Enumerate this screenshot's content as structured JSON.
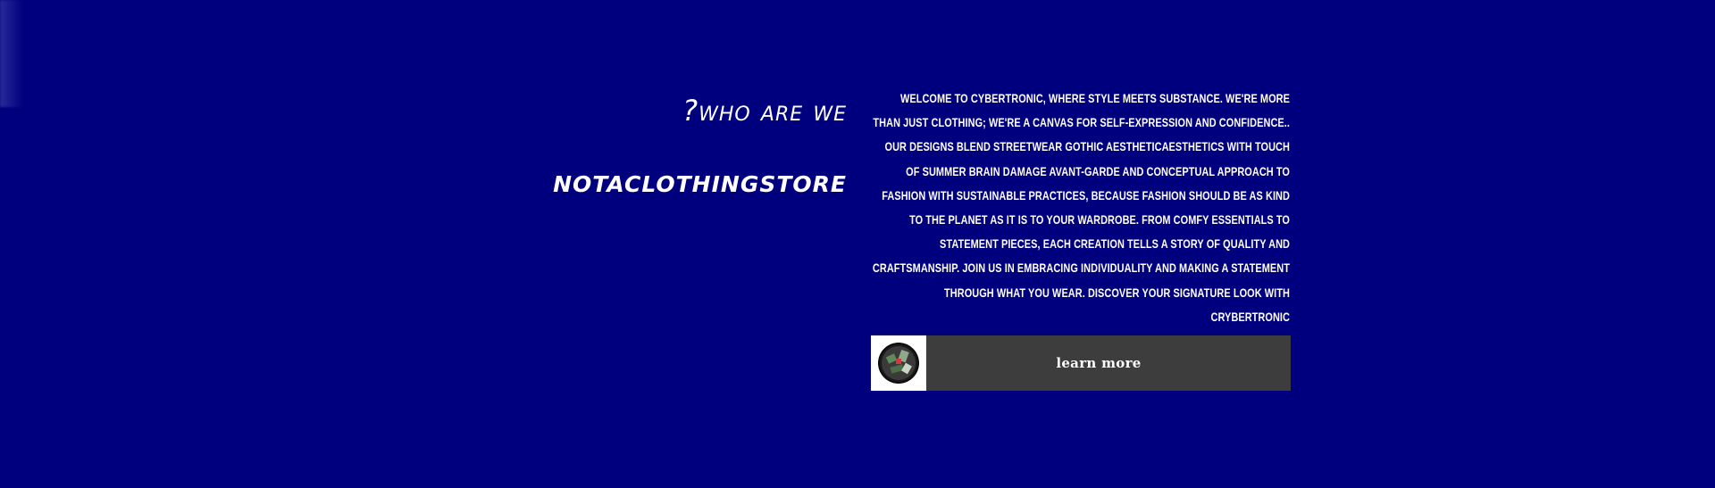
{
  "colors": {
    "background": "#00007f",
    "button_background": "#3d3d3d",
    "text": "#ffffff",
    "thumb_background": "#ffffff"
  },
  "about": {
    "eyebrow": "?who are we",
    "store_name": "notaclothingstore",
    "description": "Welcome to CyberTronic, where style meets substance. We're more than just clothing; we're a canvas for self-expression and confidence.. Our designs blend streetwear gothic aestheticaesthetics with touch of summer brain damage avant-garde and conceptual approach to fashion with sustainable practices, because fashion should be as kind to the planet as it is to your wardrobe. From comfy essentials to statement pieces, each creation tells a story of quality and craftsmanship. Join us in embracing individuality and making a statement through what you wear. Discover your signature look with CryberTronic"
  },
  "cta": {
    "label": "learn more",
    "thumbnail_icon": "circular-logo-thumbnail"
  }
}
